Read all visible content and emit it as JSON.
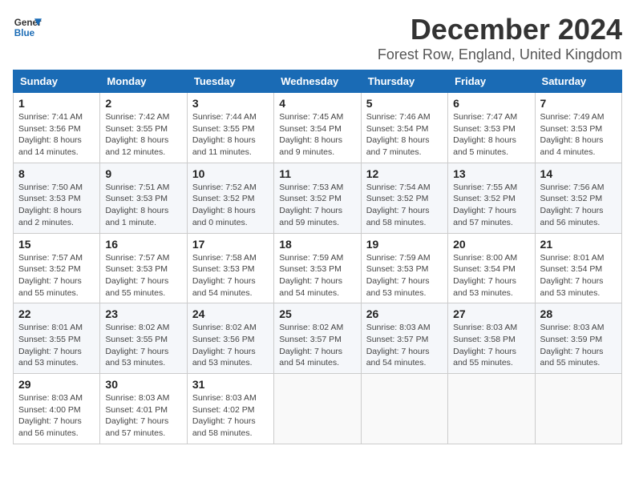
{
  "header": {
    "logo_line1": "General",
    "logo_line2": "Blue",
    "month_year": "December 2024",
    "location": "Forest Row, England, United Kingdom"
  },
  "weekdays": [
    "Sunday",
    "Monday",
    "Tuesday",
    "Wednesday",
    "Thursday",
    "Friday",
    "Saturday"
  ],
  "weeks": [
    [
      {
        "day": "1",
        "sunrise": "Sunrise: 7:41 AM",
        "sunset": "Sunset: 3:56 PM",
        "daylight": "Daylight: 8 hours and 14 minutes."
      },
      {
        "day": "2",
        "sunrise": "Sunrise: 7:42 AM",
        "sunset": "Sunset: 3:55 PM",
        "daylight": "Daylight: 8 hours and 12 minutes."
      },
      {
        "day": "3",
        "sunrise": "Sunrise: 7:44 AM",
        "sunset": "Sunset: 3:55 PM",
        "daylight": "Daylight: 8 hours and 11 minutes."
      },
      {
        "day": "4",
        "sunrise": "Sunrise: 7:45 AM",
        "sunset": "Sunset: 3:54 PM",
        "daylight": "Daylight: 8 hours and 9 minutes."
      },
      {
        "day": "5",
        "sunrise": "Sunrise: 7:46 AM",
        "sunset": "Sunset: 3:54 PM",
        "daylight": "Daylight: 8 hours and 7 minutes."
      },
      {
        "day": "6",
        "sunrise": "Sunrise: 7:47 AM",
        "sunset": "Sunset: 3:53 PM",
        "daylight": "Daylight: 8 hours and 5 minutes."
      },
      {
        "day": "7",
        "sunrise": "Sunrise: 7:49 AM",
        "sunset": "Sunset: 3:53 PM",
        "daylight": "Daylight: 8 hours and 4 minutes."
      }
    ],
    [
      {
        "day": "8",
        "sunrise": "Sunrise: 7:50 AM",
        "sunset": "Sunset: 3:53 PM",
        "daylight": "Daylight: 8 hours and 2 minutes."
      },
      {
        "day": "9",
        "sunrise": "Sunrise: 7:51 AM",
        "sunset": "Sunset: 3:53 PM",
        "daylight": "Daylight: 8 hours and 1 minute."
      },
      {
        "day": "10",
        "sunrise": "Sunrise: 7:52 AM",
        "sunset": "Sunset: 3:52 PM",
        "daylight": "Daylight: 8 hours and 0 minutes."
      },
      {
        "day": "11",
        "sunrise": "Sunrise: 7:53 AM",
        "sunset": "Sunset: 3:52 PM",
        "daylight": "Daylight: 7 hours and 59 minutes."
      },
      {
        "day": "12",
        "sunrise": "Sunrise: 7:54 AM",
        "sunset": "Sunset: 3:52 PM",
        "daylight": "Daylight: 7 hours and 58 minutes."
      },
      {
        "day": "13",
        "sunrise": "Sunrise: 7:55 AM",
        "sunset": "Sunset: 3:52 PM",
        "daylight": "Daylight: 7 hours and 57 minutes."
      },
      {
        "day": "14",
        "sunrise": "Sunrise: 7:56 AM",
        "sunset": "Sunset: 3:52 PM",
        "daylight": "Daylight: 7 hours and 56 minutes."
      }
    ],
    [
      {
        "day": "15",
        "sunrise": "Sunrise: 7:57 AM",
        "sunset": "Sunset: 3:52 PM",
        "daylight": "Daylight: 7 hours and 55 minutes."
      },
      {
        "day": "16",
        "sunrise": "Sunrise: 7:57 AM",
        "sunset": "Sunset: 3:53 PM",
        "daylight": "Daylight: 7 hours and 55 minutes."
      },
      {
        "day": "17",
        "sunrise": "Sunrise: 7:58 AM",
        "sunset": "Sunset: 3:53 PM",
        "daylight": "Daylight: 7 hours and 54 minutes."
      },
      {
        "day": "18",
        "sunrise": "Sunrise: 7:59 AM",
        "sunset": "Sunset: 3:53 PM",
        "daylight": "Daylight: 7 hours and 54 minutes."
      },
      {
        "day": "19",
        "sunrise": "Sunrise: 7:59 AM",
        "sunset": "Sunset: 3:53 PM",
        "daylight": "Daylight: 7 hours and 53 minutes."
      },
      {
        "day": "20",
        "sunrise": "Sunrise: 8:00 AM",
        "sunset": "Sunset: 3:54 PM",
        "daylight": "Daylight: 7 hours and 53 minutes."
      },
      {
        "day": "21",
        "sunrise": "Sunrise: 8:01 AM",
        "sunset": "Sunset: 3:54 PM",
        "daylight": "Daylight: 7 hours and 53 minutes."
      }
    ],
    [
      {
        "day": "22",
        "sunrise": "Sunrise: 8:01 AM",
        "sunset": "Sunset: 3:55 PM",
        "daylight": "Daylight: 7 hours and 53 minutes."
      },
      {
        "day": "23",
        "sunrise": "Sunrise: 8:02 AM",
        "sunset": "Sunset: 3:55 PM",
        "daylight": "Daylight: 7 hours and 53 minutes."
      },
      {
        "day": "24",
        "sunrise": "Sunrise: 8:02 AM",
        "sunset": "Sunset: 3:56 PM",
        "daylight": "Daylight: 7 hours and 53 minutes."
      },
      {
        "day": "25",
        "sunrise": "Sunrise: 8:02 AM",
        "sunset": "Sunset: 3:57 PM",
        "daylight": "Daylight: 7 hours and 54 minutes."
      },
      {
        "day": "26",
        "sunrise": "Sunrise: 8:03 AM",
        "sunset": "Sunset: 3:57 PM",
        "daylight": "Daylight: 7 hours and 54 minutes."
      },
      {
        "day": "27",
        "sunrise": "Sunrise: 8:03 AM",
        "sunset": "Sunset: 3:58 PM",
        "daylight": "Daylight: 7 hours and 55 minutes."
      },
      {
        "day": "28",
        "sunrise": "Sunrise: 8:03 AM",
        "sunset": "Sunset: 3:59 PM",
        "daylight": "Daylight: 7 hours and 55 minutes."
      }
    ],
    [
      {
        "day": "29",
        "sunrise": "Sunrise: 8:03 AM",
        "sunset": "Sunset: 4:00 PM",
        "daylight": "Daylight: 7 hours and 56 minutes."
      },
      {
        "day": "30",
        "sunrise": "Sunrise: 8:03 AM",
        "sunset": "Sunset: 4:01 PM",
        "daylight": "Daylight: 7 hours and 57 minutes."
      },
      {
        "day": "31",
        "sunrise": "Sunrise: 8:03 AM",
        "sunset": "Sunset: 4:02 PM",
        "daylight": "Daylight: 7 hours and 58 minutes."
      },
      null,
      null,
      null,
      null
    ]
  ]
}
